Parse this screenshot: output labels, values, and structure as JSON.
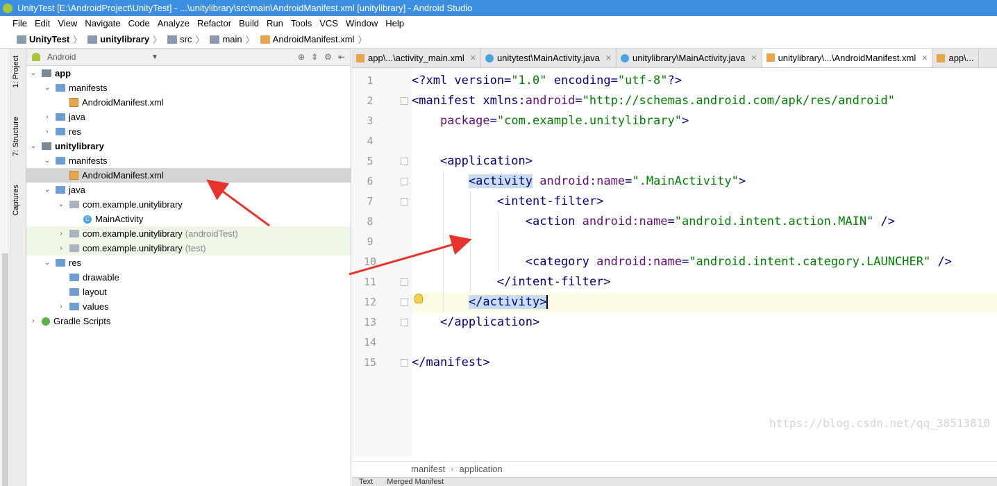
{
  "window": {
    "title": "UnityTest [E:\\AndroidProject\\UnityTest] - ...\\unitylibrary\\src\\main\\AndroidManifest.xml [unitylibrary] - Android Studio"
  },
  "menu": [
    "File",
    "Edit",
    "View",
    "Navigate",
    "Code",
    "Analyze",
    "Refactor",
    "Build",
    "Run",
    "Tools",
    "VCS",
    "Window",
    "Help"
  ],
  "breadcrumb": [
    "UnityTest",
    "unitylibrary",
    "src",
    "main",
    "AndroidManifest.xml"
  ],
  "side_tabs": [
    "1: Project",
    "7: Structure",
    "Captures"
  ],
  "project_panel": {
    "view_mode": "Android",
    "tree": [
      {
        "label": "app",
        "bold": true,
        "indent": 0,
        "expanded": true,
        "icon": "module-icon"
      },
      {
        "label": "manifests",
        "indent": 1,
        "expanded": true,
        "icon": "folder-icon"
      },
      {
        "label": "AndroidManifest.xml",
        "indent": 2,
        "icon": "xml-file-icon"
      },
      {
        "label": "java",
        "indent": 1,
        "collapsed": true,
        "icon": "folder-icon"
      },
      {
        "label": "res",
        "indent": 1,
        "collapsed": true,
        "icon": "folder-icon"
      },
      {
        "label": "unitylibrary",
        "bold": true,
        "indent": 0,
        "expanded": true,
        "icon": "module-icon"
      },
      {
        "label": "manifests",
        "indent": 1,
        "expanded": true,
        "icon": "folder-icon"
      },
      {
        "label": "AndroidManifest.xml",
        "indent": 2,
        "icon": "xml-file-icon",
        "selected": true
      },
      {
        "label": "java",
        "indent": 1,
        "expanded": true,
        "icon": "folder-icon"
      },
      {
        "label": "com.example.unitylibrary",
        "indent": 2,
        "expanded": true,
        "icon": "package-icon"
      },
      {
        "label": "MainActivity",
        "indent": 3,
        "icon": "class-icon"
      },
      {
        "label": "com.example.unitylibrary",
        "suffix": "(androidTest)",
        "indent": 2,
        "collapsed": true,
        "icon": "package-icon",
        "test": true
      },
      {
        "label": "com.example.unitylibrary",
        "suffix": "(test)",
        "indent": 2,
        "collapsed": true,
        "icon": "package-icon",
        "test": true
      },
      {
        "label": "res",
        "indent": 1,
        "expanded": true,
        "icon": "folder-icon"
      },
      {
        "label": "drawable",
        "indent": 2,
        "icon": "folder-icon"
      },
      {
        "label": "layout",
        "indent": 2,
        "icon": "folder-icon"
      },
      {
        "label": "values",
        "indent": 2,
        "collapsed": true,
        "icon": "folder-icon"
      },
      {
        "label": "Gradle Scripts",
        "indent": 0,
        "collapsed": true,
        "icon": "gradle-icon"
      }
    ]
  },
  "editor_tabs": [
    {
      "label": "app\\...\\activity_main.xml",
      "icon": "xml"
    },
    {
      "label": "unitytest\\MainActivity.java",
      "icon": "java"
    },
    {
      "label": "unitylibrary\\MainActivity.java",
      "icon": "java"
    },
    {
      "label": "unitylibrary\\...\\AndroidManifest.xml",
      "icon": "xml",
      "active": true
    },
    {
      "label": "app\\...",
      "icon": "xml"
    }
  ],
  "code_lines": [
    {
      "n": "1",
      "html": "<span class=\"tag\">&lt;?xml version=</span><span class=\"val\">\"1.0\"</span><span class=\"tag\"> encoding=</span><span class=\"val\">\"utf-8\"</span><span class=\"tag\">?&gt;</span>"
    },
    {
      "n": "2",
      "html": "<span class=\"tag\">&lt;manifest xmlns:</span><span class=\"attr\">android</span><span class=\"tag\">=</span><span class=\"val\">\"http://schemas.android.com/apk/res/android\"</span>"
    },
    {
      "n": "3",
      "html": "    <span class=\"attr\">package</span><span class=\"tag\">=</span><span class=\"val\">\"com.example.unitylibrary\"</span><span class=\"tag\">&gt;</span>"
    },
    {
      "n": "4",
      "html": ""
    },
    {
      "n": "5",
      "html": "    <span class=\"tag\">&lt;application&gt;</span>"
    },
    {
      "n": "6",
      "html": "        <span class=\"tag hl\">&lt;activity</span> <span class=\"attr\">android:name</span><span class=\"tag\">=</span><span class=\"val\">\".MainActivity\"</span><span class=\"tag\">&gt;</span>"
    },
    {
      "n": "7",
      "html": "            <span class=\"tag\">&lt;intent-filter&gt;</span>"
    },
    {
      "n": "8",
      "html": "                <span class=\"tag\">&lt;action </span><span class=\"attr\">android:name</span><span class=\"tag\">=</span><span class=\"val\">\"android.intent.action.MAIN\"</span><span class=\"tag\"> /&gt;</span>"
    },
    {
      "n": "9",
      "html": ""
    },
    {
      "n": "10",
      "html": "                <span class=\"tag\">&lt;category </span><span class=\"attr\">android:name</span><span class=\"tag\">=</span><span class=\"val\">\"android.intent.category.LAUNCHER\"</span><span class=\"tag\"> /&gt;</span>"
    },
    {
      "n": "11",
      "html": "            <span class=\"tag\">&lt;/intent-filter&gt;</span>"
    },
    {
      "n": "12",
      "html": "        <span class=\"tag hl caret\">&lt;/activity&gt;</span>",
      "current": true
    },
    {
      "n": "13",
      "html": "    <span class=\"tag\">&lt;/application&gt;</span>"
    },
    {
      "n": "14",
      "html": ""
    },
    {
      "n": "15",
      "html": "<span class=\"tag\">&lt;/manifest&gt;</span>"
    }
  ],
  "status": {
    "path": [
      "manifest",
      "application"
    ]
  },
  "bottom_tabs": [
    "Text",
    "Merged Manifest"
  ],
  "watermark": "https://blog.csdn.net/qq_38513810",
  "colors": {
    "titlebar": "#3C8FE0",
    "annotation_arrow": "#E8322C"
  }
}
